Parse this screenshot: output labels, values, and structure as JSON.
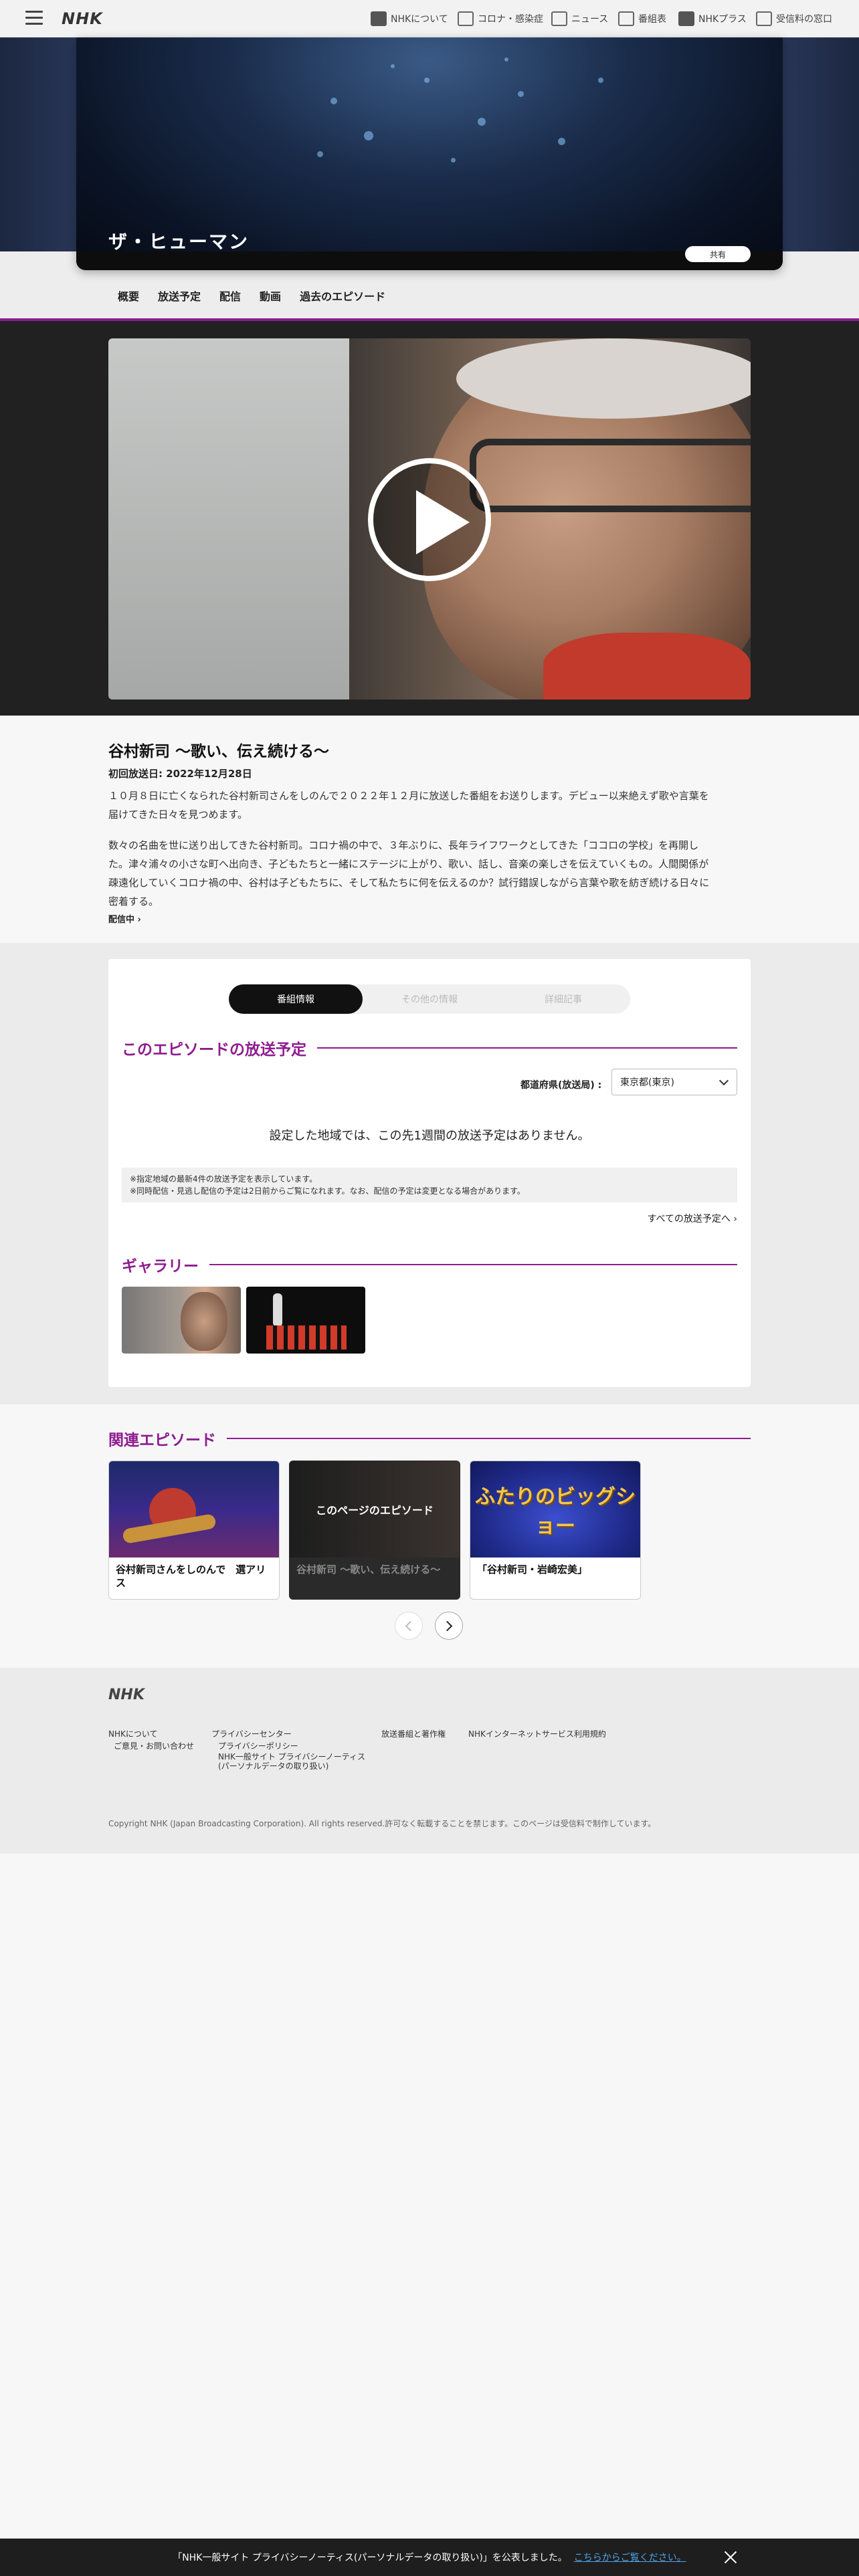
{
  "header": {
    "logo": "NHK",
    "nav": [
      {
        "label": "NHKについて",
        "icon": "nhk-icon"
      },
      {
        "label": "コロナ・感染症",
        "icon": "corona-icon"
      },
      {
        "label": "ニュース",
        "icon": "news-icon"
      },
      {
        "label": "番組表",
        "icon": "tv-guide-icon"
      },
      {
        "label": "NHKプラス",
        "icon": "nhk-plus-icon"
      },
      {
        "label": "受信料の窓口",
        "icon": "license-fee-icon"
      }
    ]
  },
  "hero": {
    "show_title": "ザ・ヒューマン",
    "share_label": "共有"
  },
  "tabs": [
    "概要",
    "放送予定",
    "配信",
    "動画",
    "過去のエピソード"
  ],
  "episode": {
    "title": "谷村新司 ～歌い、伝え続ける～",
    "first_air": "初回放送日: 2022年12月28日",
    "para1_line1": "１０月８日に亡くなられた谷村新司さんをしのんで２０２２年１２月に放送した番組をお送りします。デビュー以来絶えず歌や言葉を",
    "para1_line2": "届けてきた日々を見つめます。",
    "para2_line1": "数々の名曲を世に送り出してきた谷村新司。コロナ禍の中で、３年ぶりに、長年ライフワークとしてきた「ココロの学校」を再開し",
    "para2_line2": "た。津々浦々の小さな町へ出向き、子どもたちと一緒にステージに上がり、歌い、話し、音楽の楽しさを伝えていくもの。人間関係が",
    "para2_line3": "疎遠化していくコロナ禍の中、谷村は子どもたちに、そして私たちに何を伝えるのか？試行錯誤しながら言葉や歌を紡ぎ続ける日々に",
    "para2_line4": "密着する。",
    "stream_link": "配信中"
  },
  "schedule": {
    "segments": [
      "番組情報",
      "その他の情報",
      "詳細記事"
    ],
    "heading": "このエピソードの放送予定",
    "pref_label": "都道府県(放送局) :",
    "pref_value": "東京都(東京)",
    "no_schedule": "設定した地域では、この先1週間の放送予定はありません。",
    "note1": "※指定地域の最新4件の放送予定を表示しています。",
    "note2": "※同時配信・見逃し配信の予定は2日前からご覧になれます。なお、配信の予定は変更となる場合があります。",
    "all_link": "すべての放送予定へ"
  },
  "gallery": {
    "heading": "ギャラリー"
  },
  "related": {
    "heading": "関連エピソード",
    "cards": [
      {
        "caption": "谷村新司さんをしのんで　選アリス"
      },
      {
        "overlay": "このページのエピソード",
        "caption": "谷村新司 ～歌い、伝え続ける～"
      },
      {
        "logo_text": "ふたりのビッグショー",
        "caption": "「谷村新司・岩崎宏美」"
      }
    ]
  },
  "footer": {
    "logo": "NHK",
    "links": {
      "about": "NHKについて",
      "contact": "ご意見・お問い合わせ",
      "privacy_center": "プライバシーセンター",
      "privacy_policy": "プライバシーポリシー",
      "privacy_notice_1": "NHK一般サイト プライバシーノーティス",
      "privacy_notice_2": "(パーソナルデータの取り扱い)",
      "copyright_link": "放送番組と著作権",
      "terms": "NHKインターネットサービス利用規約"
    },
    "copyright": "Copyright NHK (Japan Broadcasting Corporation). All rights reserved.許可なく転載することを禁じます。このページは受信料で制作しています。"
  },
  "cookie": {
    "text": "「NHK一般サイト プライバシーノーティス(パーソナルデータの取り扱い)」を公表しました。",
    "link": "こちらからご覧ください。"
  },
  "colors": {
    "accent": "#8e1d90",
    "dark": "#212121"
  }
}
